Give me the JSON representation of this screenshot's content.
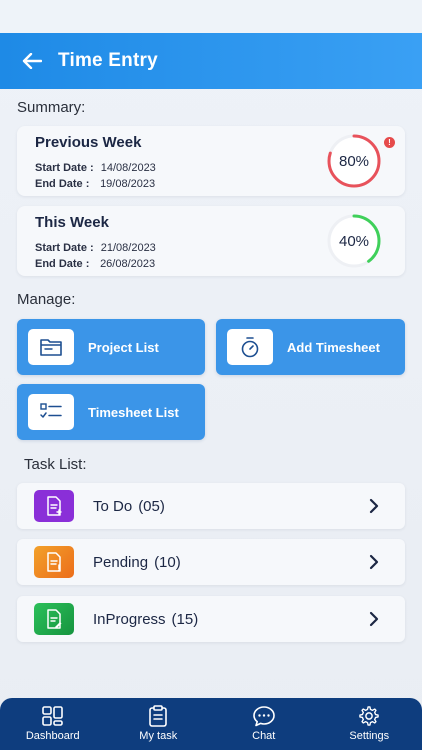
{
  "header": {
    "title": "Time Entry"
  },
  "summary": {
    "label": "Summary:",
    "previous": {
      "title": "Previous Week",
      "start_label": "Start Date :",
      "start_value": "14/08/2023",
      "end_label": "End Date   :",
      "end_value": "19/08/2023",
      "percent_text": "80%",
      "percent": 0.8,
      "alert": "!",
      "ring_color": "#e8525b"
    },
    "current": {
      "title": "This Week",
      "start_label": "Start Date :",
      "start_value": "21/08/2023",
      "end_label": "End Date   :",
      "end_value": "26/08/2023",
      "percent_text": "40%",
      "percent": 0.4,
      "ring_color": "#3fd05a"
    }
  },
  "manage": {
    "label": "Manage:",
    "project_list": "Project List",
    "add_timesheet": "Add Timesheet",
    "timesheet_list": "Timesheet List",
    "button_color": "#3b95e8"
  },
  "tasks": {
    "label": "Task List:",
    "items": [
      {
        "name": "To Do",
        "count": "(05)",
        "color": "#8a2fd8"
      },
      {
        "name": "Pending",
        "count": "(10)",
        "color": "#f08a1e"
      },
      {
        "name": "InProgress",
        "count": "(15)",
        "color": "#1fa84a"
      }
    ]
  },
  "nav": {
    "dashboard": "Dashboard",
    "my_task": "My task",
    "chat": "Chat",
    "settings": "Settings",
    "background": "#0e3d7e"
  },
  "colors": {
    "appbar": "#2b96ee"
  }
}
